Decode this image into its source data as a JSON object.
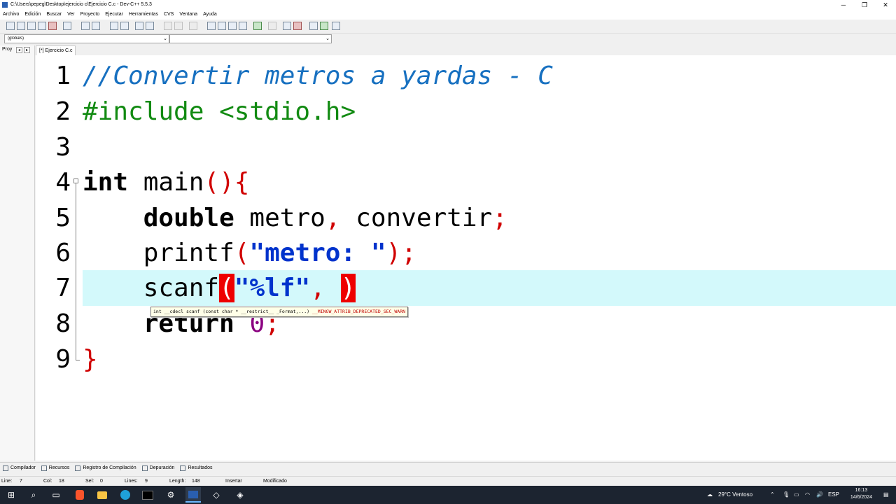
{
  "window": {
    "title": "C:\\Users\\pepeg\\Desktop\\ejercicio  c\\Ejercicio C.c - Dev-C++ 5.5.3",
    "minimize": "─",
    "maximize": "❐",
    "close": "✕"
  },
  "menu": [
    "Archivo",
    "Edición",
    "Buscar",
    "Ver",
    "Proyecto",
    "Ejecutar",
    "Herramientas",
    "CVS",
    "Ventana",
    "Ayuda"
  ],
  "scope_combo": {
    "value": "(globals)"
  },
  "symbol_combo": {
    "value": ""
  },
  "left_panel": {
    "tab_label": "Proy",
    "prev": "◂",
    "next": "▸"
  },
  "editor_tab": {
    "label": "[*] Ejercicio C.c"
  },
  "line_numbers": [
    "1",
    "2",
    "3",
    "4",
    "5",
    "6",
    "7",
    "8",
    "9"
  ],
  "code": {
    "l1": "//Convertir metros a yardas - C",
    "l2": "#include <stdio.h>",
    "l4_kw": "int",
    "l4_name": " main",
    "l4_sym": "(){",
    "l5_indent": "    ",
    "l5_kw": "double",
    "l5_a": " metro",
    "l5_comma": ",",
    "l5_b": " convertir",
    "l5_semi": ";",
    "l6_indent": "    ",
    "l6_fn": "printf",
    "l6_open": "(",
    "l6_str": "\"metro: \"",
    "l6_close": ");",
    "l7_indent": "    ",
    "l7_fn": "scanf",
    "l7_open": "(",
    "l7_str": "\"%lf\"",
    "l7_comma": ",",
    "l7_space": " ",
    "l7_close": ")",
    "l8_indent": "    ",
    "l8_kw": "return",
    "l8_space": " ",
    "l8_num": "0",
    "l8_semi": ";",
    "l9": "}"
  },
  "tooltip": {
    "signature": "int __cdecl scanf (const char * __restrict__ _Format,...) ",
    "attr": "__MINGW_ATTRIB_DEPRECATED_SEC_WARN"
  },
  "bottom_tabs": [
    "Compilador",
    "Recursos",
    "Registro de Compilación",
    "Depuración",
    "Resultados"
  ],
  "status": {
    "line_label": "Line:",
    "line": "7",
    "col_label": "Col:",
    "col": "18",
    "sel_label": "Sel:",
    "sel": "0",
    "lines_label": "Lines:",
    "lines": "9",
    "length_label": "Length:",
    "length": "148",
    "mode": "Insertar",
    "modified": "Modificado"
  },
  "taskbar": {
    "weather": "29°C  Ventoso",
    "lang": "ESP",
    "time": "16:13",
    "date": "14/6/2024"
  }
}
